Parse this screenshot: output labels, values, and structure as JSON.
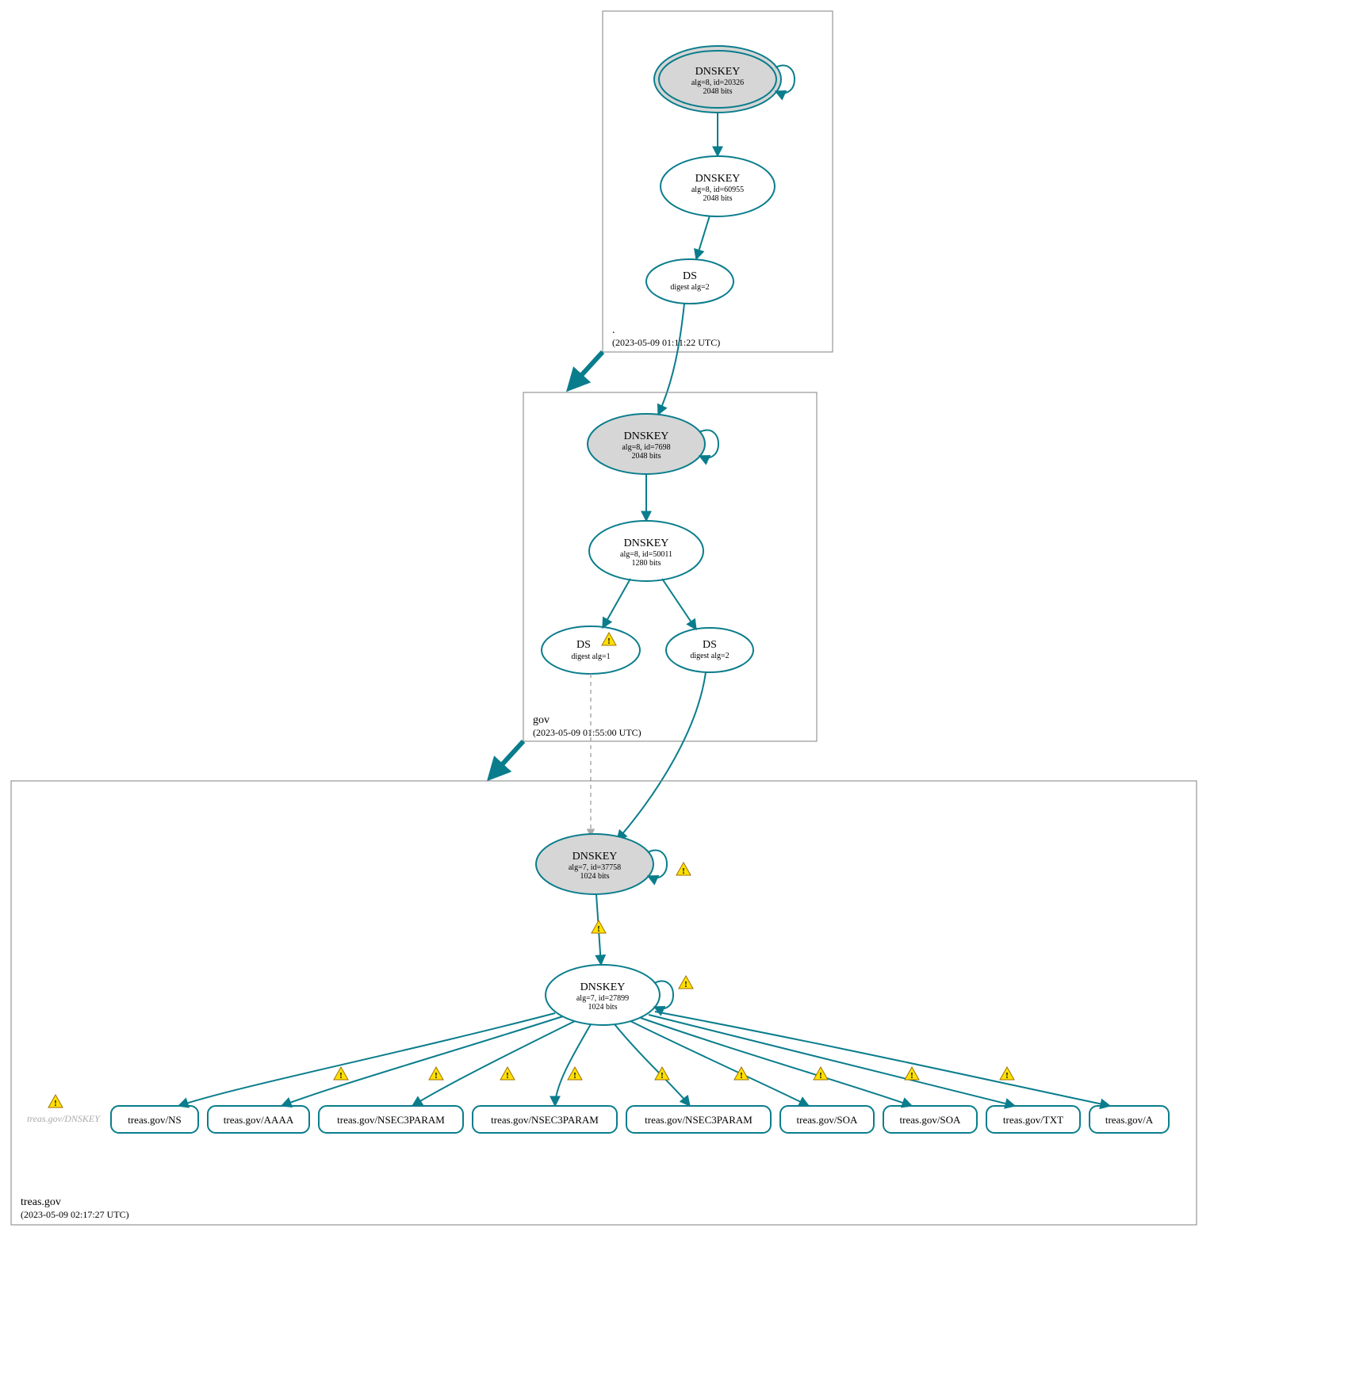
{
  "colors": {
    "teal": "#0a7d8c",
    "ksk_fill": "#d6d6d6",
    "warn_fill": "#ffe100",
    "warn_stroke": "#a07000",
    "gray": "#aaaaaa",
    "zone_border": "#808080"
  },
  "zones": {
    "root": {
      "label": ".",
      "timestamp": "(2023-05-09 01:11:22 UTC)",
      "nodes": {
        "ksk": {
          "title": "DNSKEY",
          "sub1": "alg=8, id=20326",
          "sub2": "2048 bits"
        },
        "zsk": {
          "title": "DNSKEY",
          "sub1": "alg=8, id=60955",
          "sub2": "2048 bits"
        },
        "ds": {
          "title": "DS",
          "sub1": "digest alg=2"
        }
      }
    },
    "gov": {
      "label": "gov",
      "timestamp": "(2023-05-09 01:55:00 UTC)",
      "nodes": {
        "ksk": {
          "title": "DNSKEY",
          "sub1": "alg=8, id=7698",
          "sub2": "2048 bits"
        },
        "zsk": {
          "title": "DNSKEY",
          "sub1": "alg=8, id=50011",
          "sub2": "1280 bits"
        },
        "ds1": {
          "title": "DS",
          "sub1": "digest alg=1"
        },
        "ds2": {
          "title": "DS",
          "sub1": "digest alg=2"
        }
      }
    },
    "treas": {
      "label": "treas.gov",
      "timestamp": "(2023-05-09 02:17:27 UTC)",
      "alias": "treas.gov/DNSKEY",
      "nodes": {
        "ksk": {
          "title": "DNSKEY",
          "sub1": "alg=7, id=37758",
          "sub2": "1024 bits"
        },
        "zsk": {
          "title": "DNSKEY",
          "sub1": "alg=7, id=27899",
          "sub2": "1024 bits"
        }
      },
      "rrsets": [
        "treas.gov/NS",
        "treas.gov/AAAA",
        "treas.gov/NSEC3PARAM",
        "treas.gov/NSEC3PARAM",
        "treas.gov/NSEC3PARAM",
        "treas.gov/SOA",
        "treas.gov/SOA",
        "treas.gov/TXT",
        "treas.gov/A"
      ]
    }
  }
}
